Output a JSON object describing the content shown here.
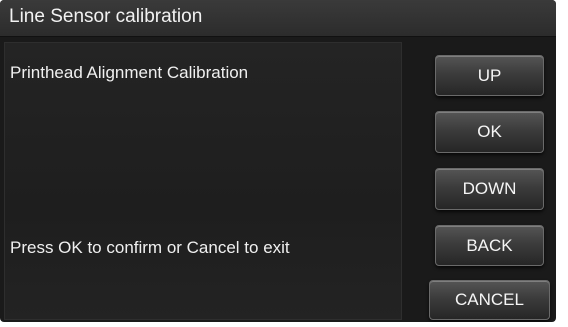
{
  "title_bar": {
    "title": "Line Sensor calibration"
  },
  "content": {
    "heading": "Printhead Alignment Calibration",
    "instruction": "Press OK to confirm or Cancel to exit"
  },
  "buttons": {
    "up": "UP",
    "ok": "OK",
    "down": "DOWN",
    "back": "BACK",
    "cancel": "CANCEL"
  },
  "colors": {
    "background": "#1a1a1a",
    "text": "#f0f0f0",
    "button_border": "#6a6a6a"
  }
}
